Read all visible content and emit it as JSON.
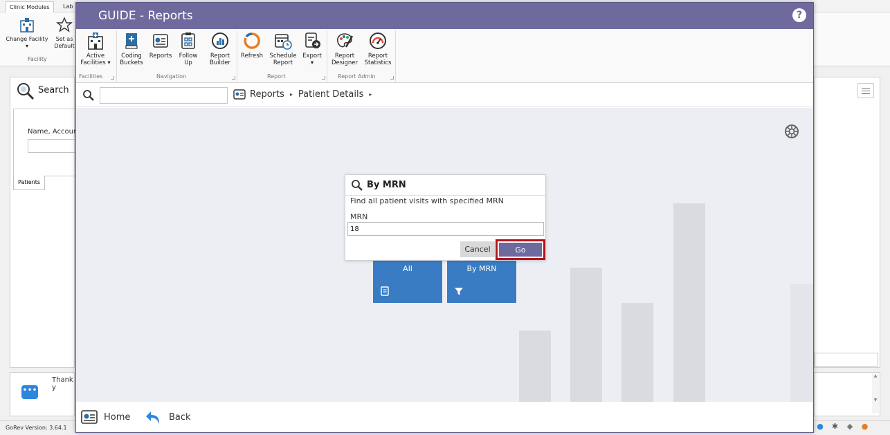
{
  "background_app": {
    "tabs": [
      "Clinic Modules",
      "Lab"
    ],
    "ribbon": {
      "change_facility": "Change Facility",
      "set_as_default": "Set as Default",
      "group_facility": "Facility"
    },
    "search_panel": {
      "title": "Search",
      "field_label": "Name, Account",
      "tab": "Patients"
    },
    "notice_text": "Thank y",
    "status_version": "GoRev Version: 3.64.1"
  },
  "window": {
    "title": "GUIDE - Reports",
    "help_icon": "?"
  },
  "ribbon": {
    "groups": {
      "facilities": "Facilities",
      "navigation": "Navigation",
      "report": "Report",
      "report_admin": "Report Admin"
    },
    "buttons": {
      "active_facilities": "Active Facilities",
      "coding_buckets": "Coding Buckets",
      "reports": "Reports",
      "follow_up": "Follow Up",
      "report_builder": "Report Builder",
      "refresh": "Refresh",
      "schedule_report": "Schedule Report",
      "export": "Export",
      "report_designer": "Report Designer",
      "report_statistics": "Report Statistics"
    },
    "dropdown_arrow": "▾"
  },
  "navbar": {
    "search_value": "",
    "breadcrumb": [
      "Reports",
      "Patient Details"
    ],
    "separator": "▸"
  },
  "dialog": {
    "title": "By MRN",
    "description": "Find all patient visits with specified MRN",
    "field_label": "MRN",
    "field_value": "18",
    "cancel_label": "Cancel",
    "go_label": "Go"
  },
  "tiles": [
    {
      "label": "All",
      "icon": "report-icon"
    },
    {
      "label": "By MRN",
      "icon": "filter-icon"
    }
  ],
  "footer": {
    "home_label": "Home",
    "back_label": "Back"
  },
  "colors": {
    "title_bar": "#6e6a9e",
    "tile": "#3a7cc4",
    "highlight": "#b5121b"
  }
}
